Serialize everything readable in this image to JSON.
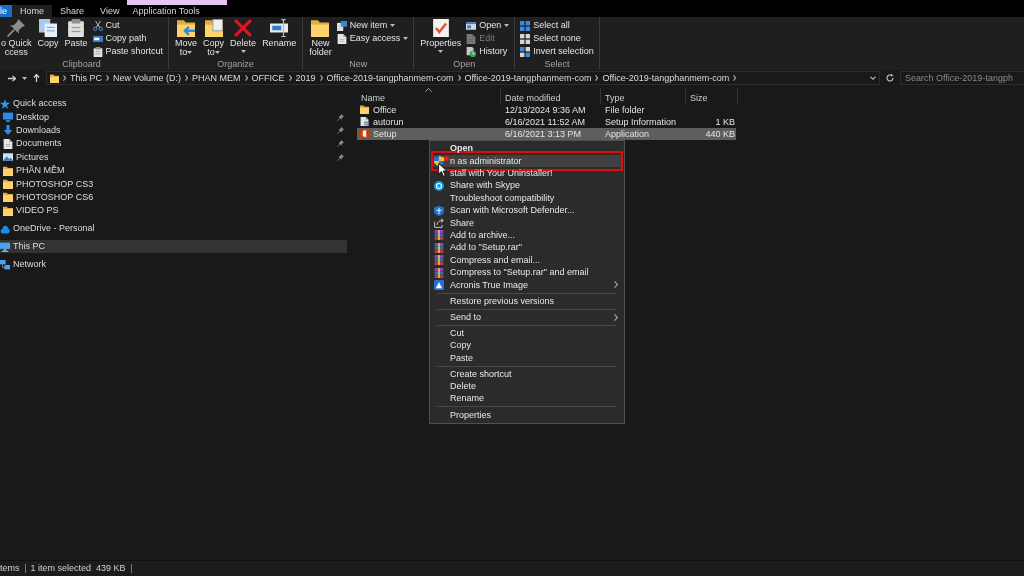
{
  "tabs": [
    {
      "label": "le",
      "kind": "file",
      "selected": false,
      "contextual": false
    },
    {
      "label": "Home",
      "kind": "tab",
      "selected": true,
      "contextual": false
    },
    {
      "label": "Share",
      "kind": "tab",
      "selected": false,
      "contextual": false
    },
    {
      "label": "View",
      "kind": "tab",
      "selected": false,
      "contextual": false
    },
    {
      "label": "Application Tools",
      "kind": "tab",
      "selected": false,
      "contextual": true
    }
  ],
  "ribbon": {
    "groups": [
      {
        "label": "Clipboard",
        "items": [
          {
            "kind": "large",
            "lines": [
              "o Quick",
              "ccess"
            ],
            "disabled": false,
            "dropdown": false
          },
          {
            "kind": "large",
            "lines": [
              "Copy"
            ],
            "disabled": false,
            "dropdown": false
          },
          {
            "kind": "large",
            "lines": [
              "Paste"
            ],
            "disabled": false,
            "dropdown": false
          },
          {
            "kind": "stack",
            "items": [
              {
                "label": "Cut",
                "disabled": false,
                "dropdown": false
              },
              {
                "label": "Copy path",
                "disabled": false,
                "dropdown": false
              },
              {
                "label": "Paste shortcut",
                "disabled": false,
                "dropdown": false
              }
            ]
          }
        ]
      },
      {
        "label": "Organize",
        "items": [
          {
            "kind": "large",
            "lines": [
              "Move",
              "to"
            ],
            "disabled": false,
            "dropdown": true
          },
          {
            "kind": "large",
            "lines": [
              "Copy",
              "to"
            ],
            "disabled": false,
            "dropdown": true
          },
          {
            "kind": "large",
            "lines": [
              "Delete"
            ],
            "disabled": false,
            "dropdown": true
          },
          {
            "kind": "large",
            "lines": [
              "Rename"
            ],
            "disabled": false,
            "dropdown": false
          }
        ]
      },
      {
        "label": "New",
        "items": [
          {
            "kind": "large",
            "lines": [
              "New",
              "folder"
            ],
            "disabled": false,
            "dropdown": false
          },
          {
            "kind": "stack",
            "items": [
              {
                "label": "New item",
                "disabled": false,
                "dropdown": true
              },
              {
                "label": "Easy access",
                "disabled": false,
                "dropdown": true
              }
            ]
          }
        ]
      },
      {
        "label": "Open",
        "items": [
          {
            "kind": "large",
            "lines": [
              "Properties"
            ],
            "disabled": false,
            "dropdown": true
          },
          {
            "kind": "stack",
            "items": [
              {
                "label": "Open",
                "disabled": false,
                "dropdown": true
              },
              {
                "label": "Edit",
                "disabled": true,
                "dropdown": false
              },
              {
                "label": "History",
                "disabled": false,
                "dropdown": false
              }
            ]
          }
        ]
      },
      {
        "label": "Select",
        "items": [
          {
            "kind": "stack",
            "items": [
              {
                "label": "Select all",
                "disabled": false,
                "dropdown": false
              },
              {
                "label": "Select none",
                "disabled": false,
                "dropdown": false
              },
              {
                "label": "Invert selection",
                "disabled": false,
                "dropdown": false
              }
            ]
          }
        ]
      }
    ]
  },
  "address_bar": {
    "breadcrumbs": [
      "This PC",
      "New Volume (D:)",
      "PHAN MEM",
      "OFFICE",
      "2019",
      "Office-2019-tangphanmem-com",
      "Office-2019-tangphanmem-com",
      "Office-2019-tangphanmem-com"
    ],
    "search": {
      "placeholder": "Search Office-2019-tangph"
    }
  },
  "navigation_pane": {
    "items": [
      {
        "label": "Quick access",
        "selected": false,
        "pinned": false,
        "children": [
          {
            "label": "Desktop",
            "selected": false,
            "pinned": true
          },
          {
            "label": "Downloads",
            "selected": false,
            "pinned": true
          },
          {
            "label": "Documents",
            "selected": false,
            "pinned": true
          },
          {
            "label": "Pictures",
            "selected": false,
            "pinned": true
          },
          {
            "label": "PHẦN MỀM",
            "selected": false,
            "pinned": false
          },
          {
            "label": "PHOTOSHOP CS3",
            "selected": false,
            "pinned": false
          },
          {
            "label": "PHOTOSHOP CS6",
            "selected": false,
            "pinned": false
          },
          {
            "label": "VIDEO PS",
            "selected": false,
            "pinned": false
          }
        ]
      },
      {
        "label": "OneDrive - Personal",
        "selected": false,
        "pinned": false
      },
      {
        "label": "This PC",
        "selected": true,
        "pinned": false
      },
      {
        "label": "Network",
        "selected": false,
        "pinned": false
      }
    ]
  },
  "file_list": {
    "columns": [
      {
        "label": "Name",
        "sorted": true
      },
      {
        "label": "Date modified",
        "sorted": false
      },
      {
        "label": "Type",
        "sorted": false
      },
      {
        "label": "Size",
        "sorted": false
      }
    ],
    "rows": [
      {
        "name": "Office",
        "date_modified": "12/13/2024 9:36 AM",
        "type": "File folder",
        "selected": false
      },
      {
        "name": "autorun",
        "date_modified": "6/16/2021 11:52 AM",
        "type": "Setup Information",
        "size": "1 KB",
        "selected": false
      },
      {
        "name": "Setup",
        "date_modified": "6/16/2021 3:13 PM",
        "type": "Application",
        "size": "440 KB",
        "selected": true
      }
    ]
  },
  "context_menu": {
    "items": [
      {
        "kind": "item",
        "label": "Open",
        "default": true,
        "selected": false,
        "annotated": false,
        "submenu": false
      },
      {
        "kind": "item",
        "label": "n as administrator",
        "default": false,
        "selected": true,
        "annotated": true,
        "submenu": false
      },
      {
        "kind": "item",
        "label": "stall with Your Uninstaller!",
        "default": false,
        "selected": false,
        "annotated": false,
        "submenu": false
      },
      {
        "kind": "item",
        "label": "Share with Skype",
        "default": false,
        "selected": false,
        "annotated": false,
        "submenu": false
      },
      {
        "kind": "item",
        "label": "Troubleshoot compatibility",
        "default": false,
        "selected": false,
        "annotated": false,
        "submenu": false
      },
      {
        "kind": "item",
        "label": "Scan with Microsoft Defender...",
        "default": false,
        "selected": false,
        "annotated": false,
        "submenu": false
      },
      {
        "kind": "item",
        "label": "Share",
        "default": false,
        "selected": false,
        "annotated": false,
        "submenu": false
      },
      {
        "kind": "item",
        "label": "Add to archive...",
        "default": false,
        "selected": false,
        "annotated": false,
        "submenu": false
      },
      {
        "kind": "item",
        "label": "Add to \"Setup.rar\"",
        "default": false,
        "selected": false,
        "annotated": false,
        "submenu": false
      },
      {
        "kind": "item",
        "label": "Compress and email...",
        "default": false,
        "selected": false,
        "annotated": false,
        "submenu": false
      },
      {
        "kind": "item",
        "label": "Compress to \"Setup.rar\" and email",
        "default": false,
        "selected": false,
        "annotated": false,
        "submenu": false
      },
      {
        "kind": "item",
        "label": "Acronis True Image",
        "default": false,
        "selected": false,
        "annotated": false,
        "submenu": true
      },
      {
        "kind": "separator"
      },
      {
        "kind": "item",
        "label": "Restore previous versions",
        "default": false,
        "selected": false,
        "annotated": false,
        "submenu": false
      },
      {
        "kind": "separator"
      },
      {
        "kind": "item",
        "label": "Send to",
        "default": false,
        "selected": false,
        "annotated": false,
        "submenu": true
      },
      {
        "kind": "separator"
      },
      {
        "kind": "item",
        "label": "Cut",
        "default": false,
        "selected": false,
        "annotated": false,
        "submenu": false
      },
      {
        "kind": "item",
        "label": "Copy",
        "default": false,
        "selected": false,
        "annotated": false,
        "submenu": false
      },
      {
        "kind": "item",
        "label": "Paste",
        "default": false,
        "selected": false,
        "annotated": false,
        "submenu": false
      },
      {
        "kind": "separator"
      },
      {
        "kind": "item",
        "label": "Create shortcut",
        "default": false,
        "selected": false,
        "annotated": false,
        "submenu": false
      },
      {
        "kind": "item",
        "label": "Delete",
        "default": false,
        "selected": false,
        "annotated": false,
        "submenu": false
      },
      {
        "kind": "item",
        "label": "Rename",
        "default": false,
        "selected": false,
        "annotated": false,
        "submenu": false
      },
      {
        "kind": "separator"
      },
      {
        "kind": "item",
        "label": "Properties",
        "default": false,
        "selected": false,
        "annotated": false,
        "submenu": false
      }
    ]
  },
  "status_bar": {
    "items": [
      "tems",
      "1 item selected",
      "439 KB"
    ]
  }
}
